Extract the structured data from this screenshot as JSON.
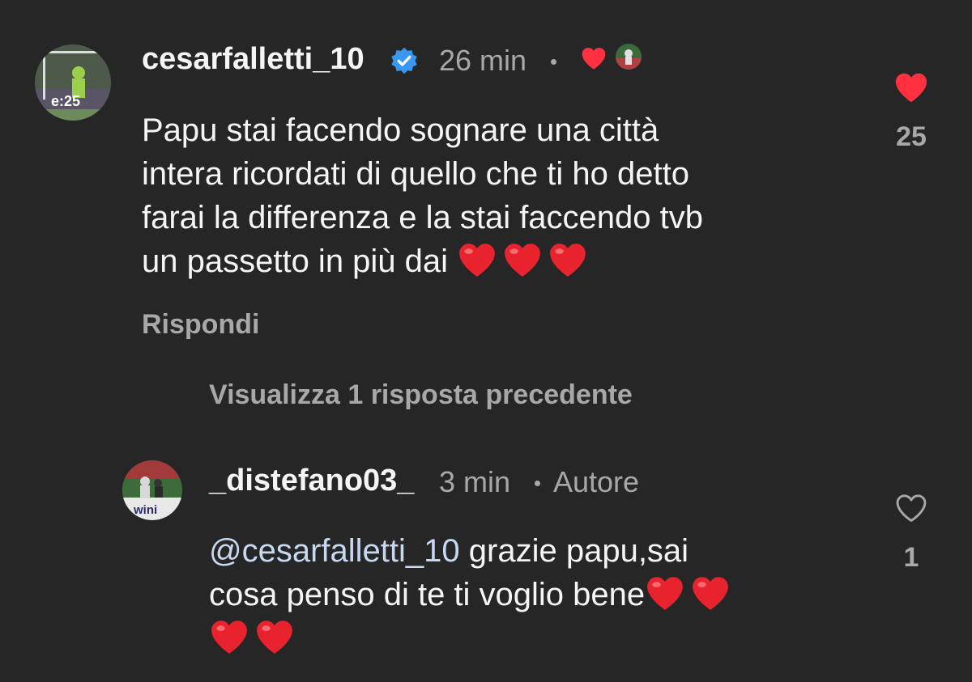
{
  "comment": {
    "username": "cesarfalletti_10",
    "verified": true,
    "time": "26 min",
    "lines": [
      "Papu stai facendo sognare una città",
      "intera ricordati di quello che ti ho detto",
      "farai la differenza e la stai faccendo tvb",
      "un passetto in più dai"
    ],
    "trailing_emoji": "❤️❤️❤️",
    "like_count": "25",
    "liked": true,
    "reply_label": "Rispondi",
    "author_liked_icon": "heart-icon",
    "colors": {
      "like_red": "#ff3040",
      "verified_blue": "#3897f0"
    }
  },
  "view_replies": "Visualizza 1 risposta precedente",
  "reply": {
    "username": "_distefano03_",
    "time": "3 min",
    "author_label": "Autore",
    "mention": "@cesarfalletti_10",
    "line1_rest": " grazie papu,sai",
    "line2": "cosa penso di te ti voglio bene",
    "line2_emoji": "❤️❤️",
    "line3_emoji": "❤️❤️",
    "like_count": "1",
    "liked": false
  }
}
